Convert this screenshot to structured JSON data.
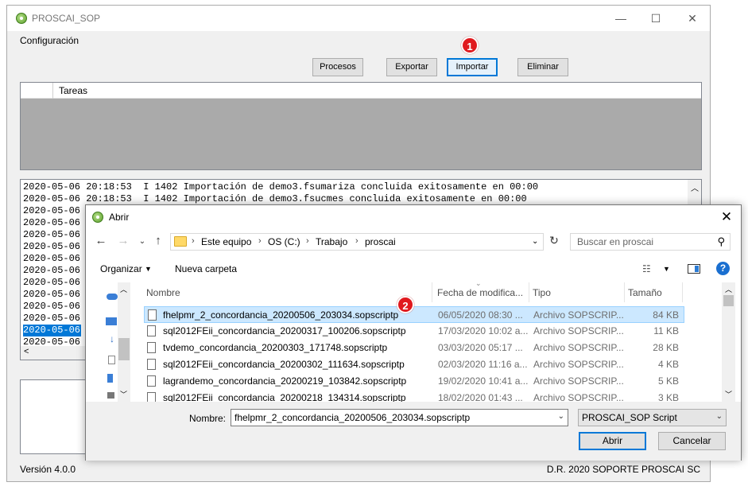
{
  "main_window": {
    "title": "PROSCAI_SOP",
    "controls": {
      "minimize": "—",
      "maximize": "☐",
      "close": "✕"
    },
    "menu": {
      "configuracion": "Configuración"
    },
    "toolbar": {
      "procesos": "Procesos",
      "exportar": "Exportar",
      "importar": "Importar",
      "eliminar": "Eliminar"
    },
    "tasks_column": "Tareas",
    "log_lines": [
      "2020-05-06 20:18:53  I 1402 Importación de demo3.fsumariza concluida exitosamente en 00:00",
      "2020-05-06 20:18:53  I 1402 Importación de demo3.fsucmes concluida exitosamente en 00:00",
      "2020-05-06",
      "2020-05-06",
      "2020-05-06",
      "2020-05-06",
      "2020-05-06",
      "2020-05-06",
      "2020-05-06",
      "2020-05-06",
      "2020-05-06",
      "2020-05-06",
      "2020-05-06",
      "2020-05-06"
    ],
    "version": "Versión 4.0.0",
    "copyright": "D.R. 2020 SOPORTE PROSCAI SC"
  },
  "badges": {
    "one": "1",
    "two": "2"
  },
  "dialog": {
    "title": "Abrir",
    "breadcrumbs": [
      "Este equipo",
      "OS (C:)",
      "Trabajo",
      "proscai"
    ],
    "search_placeholder": "Buscar en proscai",
    "organizar": "Organizar",
    "nueva_carpeta": "Nueva carpeta",
    "columns": {
      "name": "Nombre",
      "date": "Fecha de modifica...",
      "type": "Tipo",
      "size": "Tamaño"
    },
    "files": [
      {
        "name": "fhelpmr_2_concordancia_20200506_203034.sopscriptp",
        "date": "06/05/2020 08:30 ...",
        "type": "Archivo SOPSCRIP...",
        "size": "84 KB"
      },
      {
        "name": "sql2012FEii_concordancia_20200317_100206.sopscriptp",
        "date": "17/03/2020 10:02 a...",
        "type": "Archivo SOPSCRIP...",
        "size": "11 KB"
      },
      {
        "name": "tvdemo_concordancia_20200303_171748.sopscriptp",
        "date": "03/03/2020 05:17 ...",
        "type": "Archivo SOPSCRIP...",
        "size": "28 KB"
      },
      {
        "name": "sql2012FEii_concordancia_20200302_111634.sopscriptp",
        "date": "02/03/2020 11:16 a...",
        "type": "Archivo SOPSCRIP...",
        "size": "4 KB"
      },
      {
        "name": "lagrandemo_concordancia_20200219_103842.sopscriptp",
        "date": "19/02/2020 10:41 a...",
        "type": "Archivo SOPSCRIP...",
        "size": "5 KB"
      },
      {
        "name": "sql2012FEii_concordancia_20200218_134314.sopscriptp",
        "date": "18/02/2020 01:43 ...",
        "type": "Archivo SOPSCRIP...",
        "size": "3 KB"
      }
    ],
    "name_label": "Nombre:",
    "name_value": "fhelpmr_2_concordancia_20200506_203034.sopscriptp",
    "file_type": "PROSCAI_SOP Script",
    "abrir": "Abrir",
    "cancelar": "Cancelar"
  }
}
